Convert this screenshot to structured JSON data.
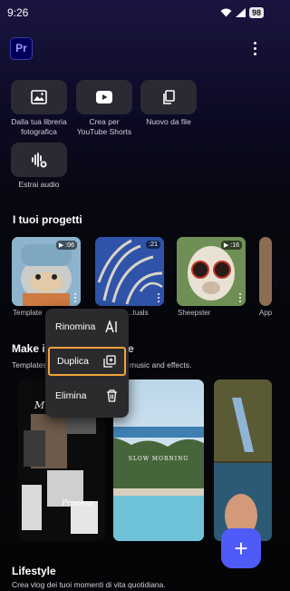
{
  "status": {
    "time": "9:26",
    "battery": "98"
  },
  "app": {
    "logo": "Pr"
  },
  "actions": [
    {
      "label": "Dalla tua libreria fotografica",
      "icon": "photo-library-icon"
    },
    {
      "label": "Crea per YouTube Shorts",
      "icon": "youtube-icon"
    },
    {
      "label": "Nuovo da file",
      "icon": "file-copy-icon"
    },
    {
      "label": "Estrai audio",
      "icon": "audio-extract-icon"
    }
  ],
  "projects_title": "I tuoi progetti",
  "projects": [
    {
      "label": "Template",
      "duration": ":06"
    },
    {
      "label": "...tuals",
      "duration": ":21"
    },
    {
      "label": "Sheepster",
      "duration": ":16"
    },
    {
      "label": "App"
    }
  ],
  "menu": {
    "items": [
      "Rinomina",
      "Duplica",
      "Elimina"
    ],
    "selected": "Duplica",
    "highlight_color": "#f3a23a"
  },
  "make_section": {
    "title_start": "Make it",
    "title_end": "e",
    "subtitle_start": "Templates",
    "subtitle_end": "music and effects."
  },
  "templates": [
    {
      "caption_top": "M",
      "caption_bottom": "Process"
    },
    {
      "caption": "SLOW MORNING"
    },
    {}
  ],
  "lifestyle": {
    "title": "Lifestyle",
    "subtitle": "Crea vlog dei tuoi momenti di vita quotidiana."
  },
  "colors": {
    "accent": "#4f5bf7",
    "fab": "#4f5bf7"
  }
}
